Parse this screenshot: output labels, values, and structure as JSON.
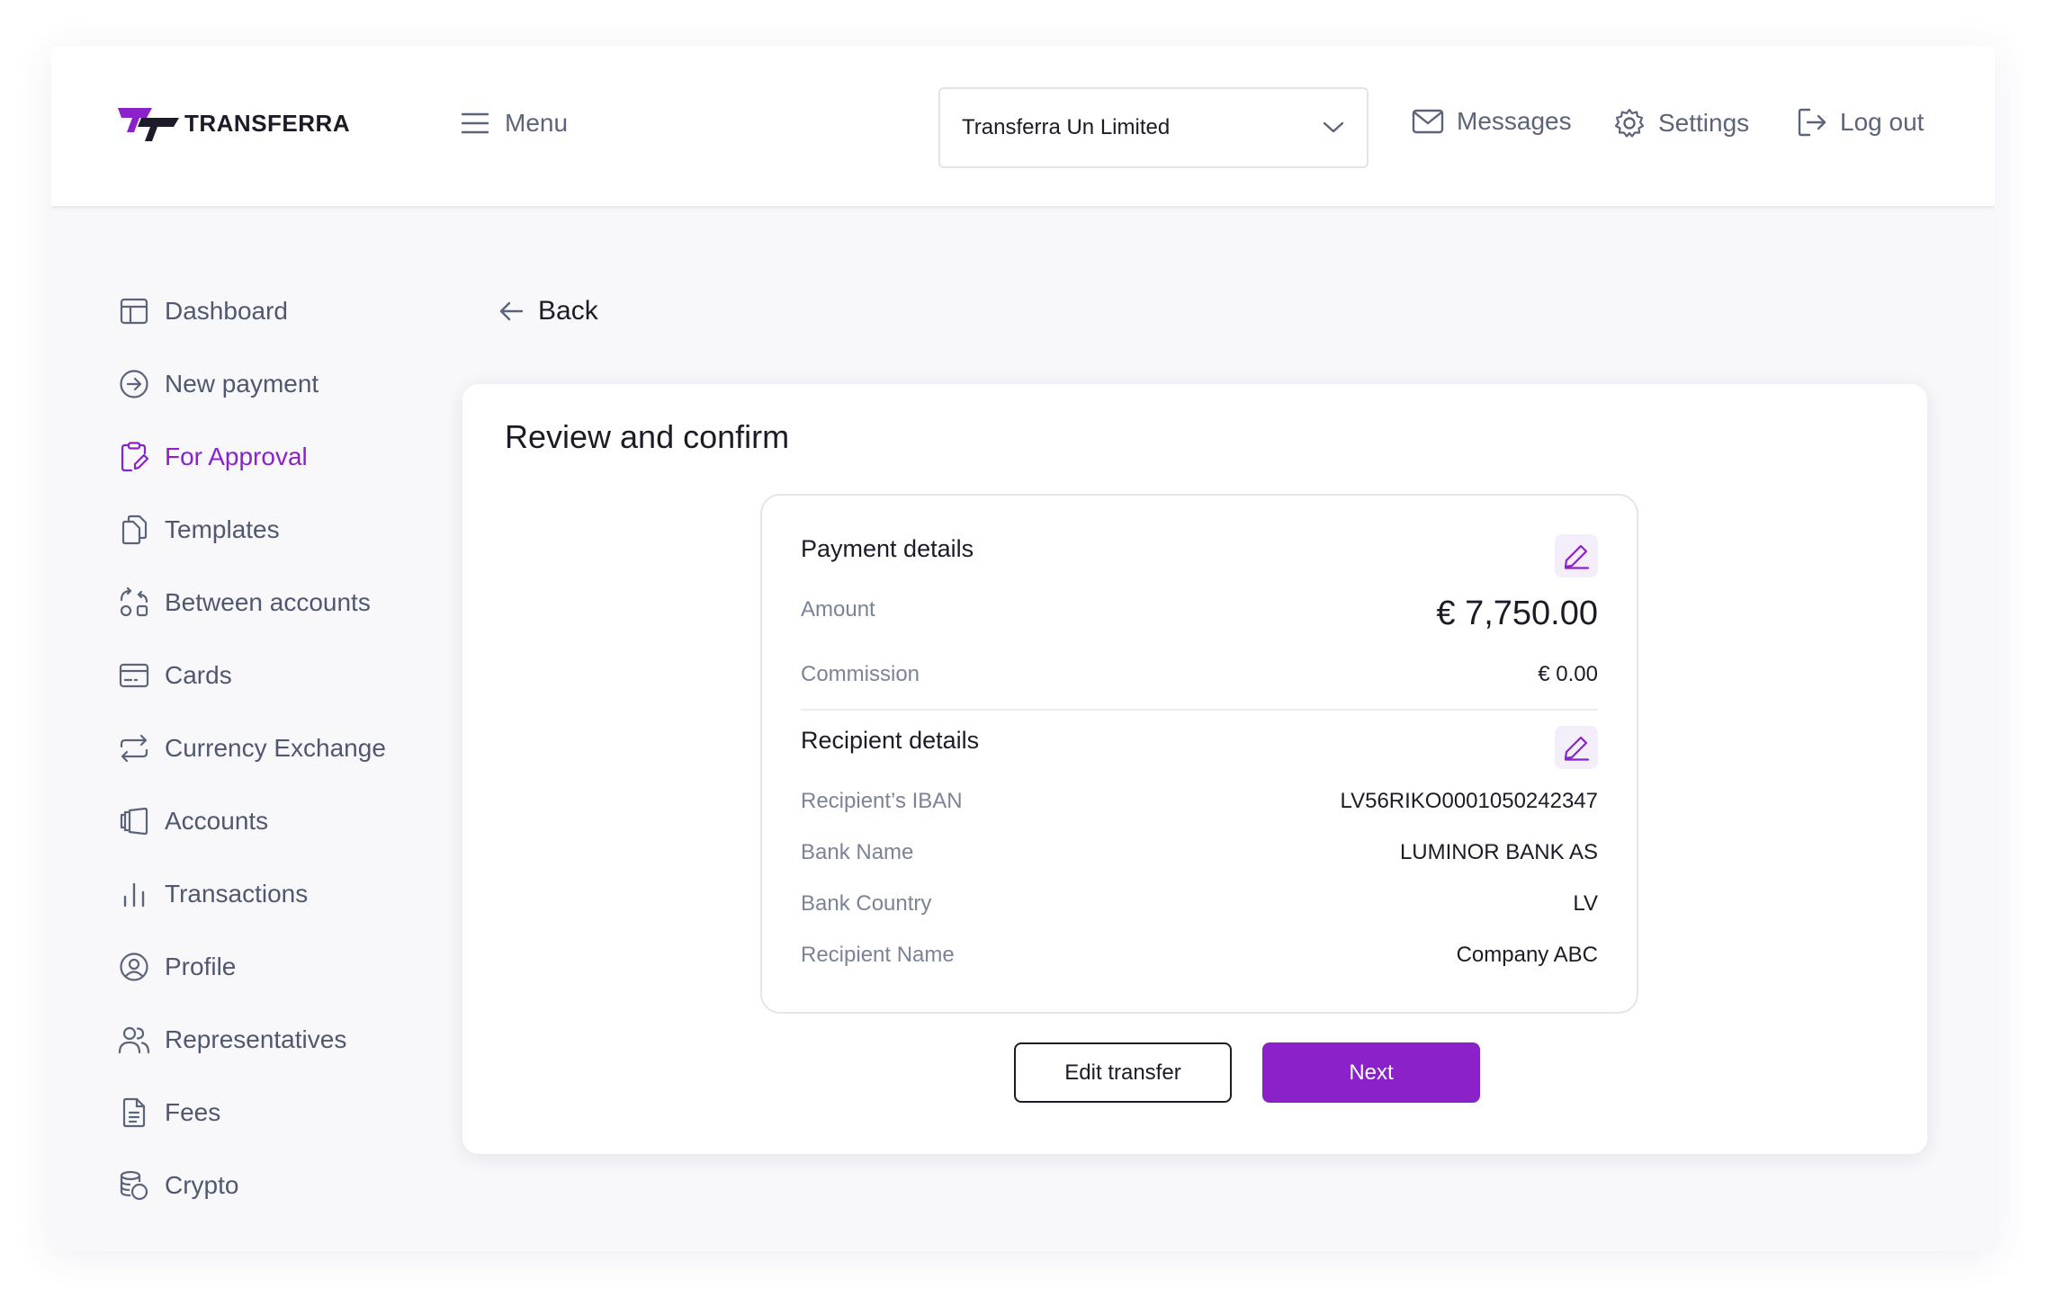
{
  "brand": {
    "name": "TRANSFERRA",
    "primary_color": "#8b22c9"
  },
  "header": {
    "menu_label": "Menu",
    "company_select": {
      "value": "Transferra Un Limited"
    },
    "messages_label": "Messages",
    "settings_label": "Settings",
    "logout_label": "Log out"
  },
  "sidebar": {
    "items": [
      {
        "label": "Dashboard",
        "icon": "layout-icon"
      },
      {
        "label": "New payment",
        "icon": "arrow-circle-icon"
      },
      {
        "label": "For Approval",
        "icon": "clipboard-edit-icon",
        "active": true
      },
      {
        "label": "Templates",
        "icon": "copy-icon"
      },
      {
        "label": "Between accounts",
        "icon": "transfer-icon"
      },
      {
        "label": "Cards",
        "icon": "card-icon"
      },
      {
        "label": "Currency Exchange",
        "icon": "repeat-icon"
      },
      {
        "label": "Accounts",
        "icon": "wallet-icon"
      },
      {
        "label": "Transactions",
        "icon": "bars-icon"
      },
      {
        "label": "Profile",
        "icon": "user-circle-icon"
      },
      {
        "label": "Representatives",
        "icon": "users-icon"
      },
      {
        "label": "Fees",
        "icon": "document-icon"
      },
      {
        "label": "Crypto",
        "icon": "coins-icon"
      }
    ]
  },
  "main": {
    "back_label": "Back",
    "title": "Review and confirm",
    "payment_details": {
      "title": "Payment details",
      "amount_label": "Amount",
      "amount_value": "€ 7,750.00",
      "commission_label": "Commission",
      "commission_value": "€ 0.00"
    },
    "recipient_details": {
      "title": "Recipient details",
      "rows": [
        {
          "label": "Recipient’s IBAN",
          "value": "LV56RIKO0001050242347"
        },
        {
          "label": "Bank Name",
          "value": "LUMINOR BANK AS"
        },
        {
          "label": "Bank Country",
          "value": "LV"
        },
        {
          "label": "Recipient Name",
          "value": "Company ABC"
        }
      ]
    },
    "edit_button": "Edit transfer",
    "next_button": "Next"
  }
}
